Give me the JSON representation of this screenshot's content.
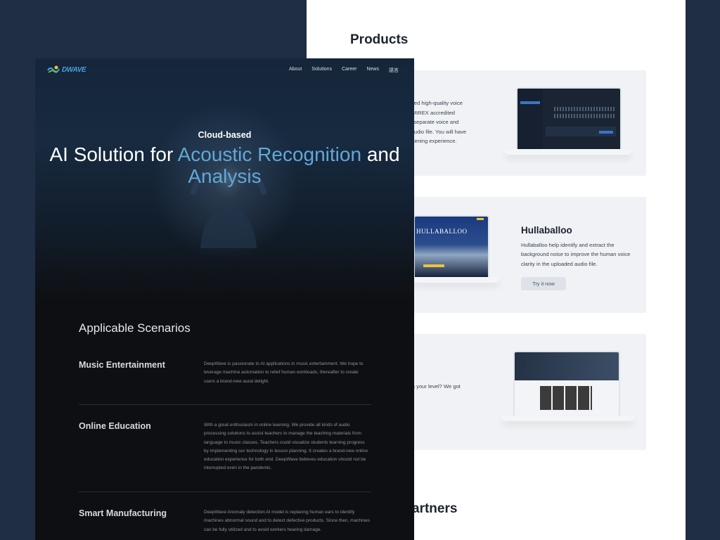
{
  "products": {
    "title": "Products",
    "cards": [
      {
        "text_lines": [
          "trained high-quality voice",
          "his MIREX accredited",
          "you separate voice and",
          "an audio file. You will have",
          "g/listening experience."
        ]
      },
      {
        "name": "Hullaballoo",
        "description": "Hullaballoo help identify and extract the background noise to improve the human voice clarity in the uploaded audio file.",
        "button_label": "Try it now",
        "screen_title": "HULLABALLOO"
      },
      {
        "text_lines": [
          "b fits your level? We got"
        ]
      }
    ]
  },
  "partners": {
    "title": "artners"
  },
  "nav": {
    "logo_text": "DWAVE",
    "items": [
      "About",
      "Solutions",
      "Career",
      "News",
      "語言"
    ]
  },
  "hero": {
    "eyebrow": "Cloud-based",
    "title_part1": "AI Solution for ",
    "title_highlight1": "Acoustic Recognition",
    "title_part2": " and ",
    "title_highlight2": "Analysis",
    "highlight_color": "#62a8d6"
  },
  "scenarios": {
    "title": "Applicable Scenarios",
    "items": [
      {
        "name": "Music Entertainment",
        "description": "DeepWave is passionate to AI applications in music entertainment. We hope to leverage machine automation to relief human workloads, thereafter to create users a brand-new aural delight."
      },
      {
        "name": "Online Education",
        "description": "With a great enthusiasm in online learning. We provide all kinds of audio processing solutions to assist teachers to manage the teaching materials from language to music classes. Teachers could visualize students learning progress by implementing our technology in lesson planning. It creates a brand-new online education experience for both end. DeepWave believes education should not be interrupted even in the pandemic."
      },
      {
        "name": "Smart Manufacturing",
        "description": "DeepWave Anomaly detection AI model is replacing human ears to identify machines abnormal sound and to detect defective products. Since then, machines can be fully utilized and to avoid workers hearing damage."
      }
    ]
  },
  "colors": {
    "background": "#1f2e45",
    "dark_page": "#0e0f12",
    "accent": "#62a8d6"
  }
}
